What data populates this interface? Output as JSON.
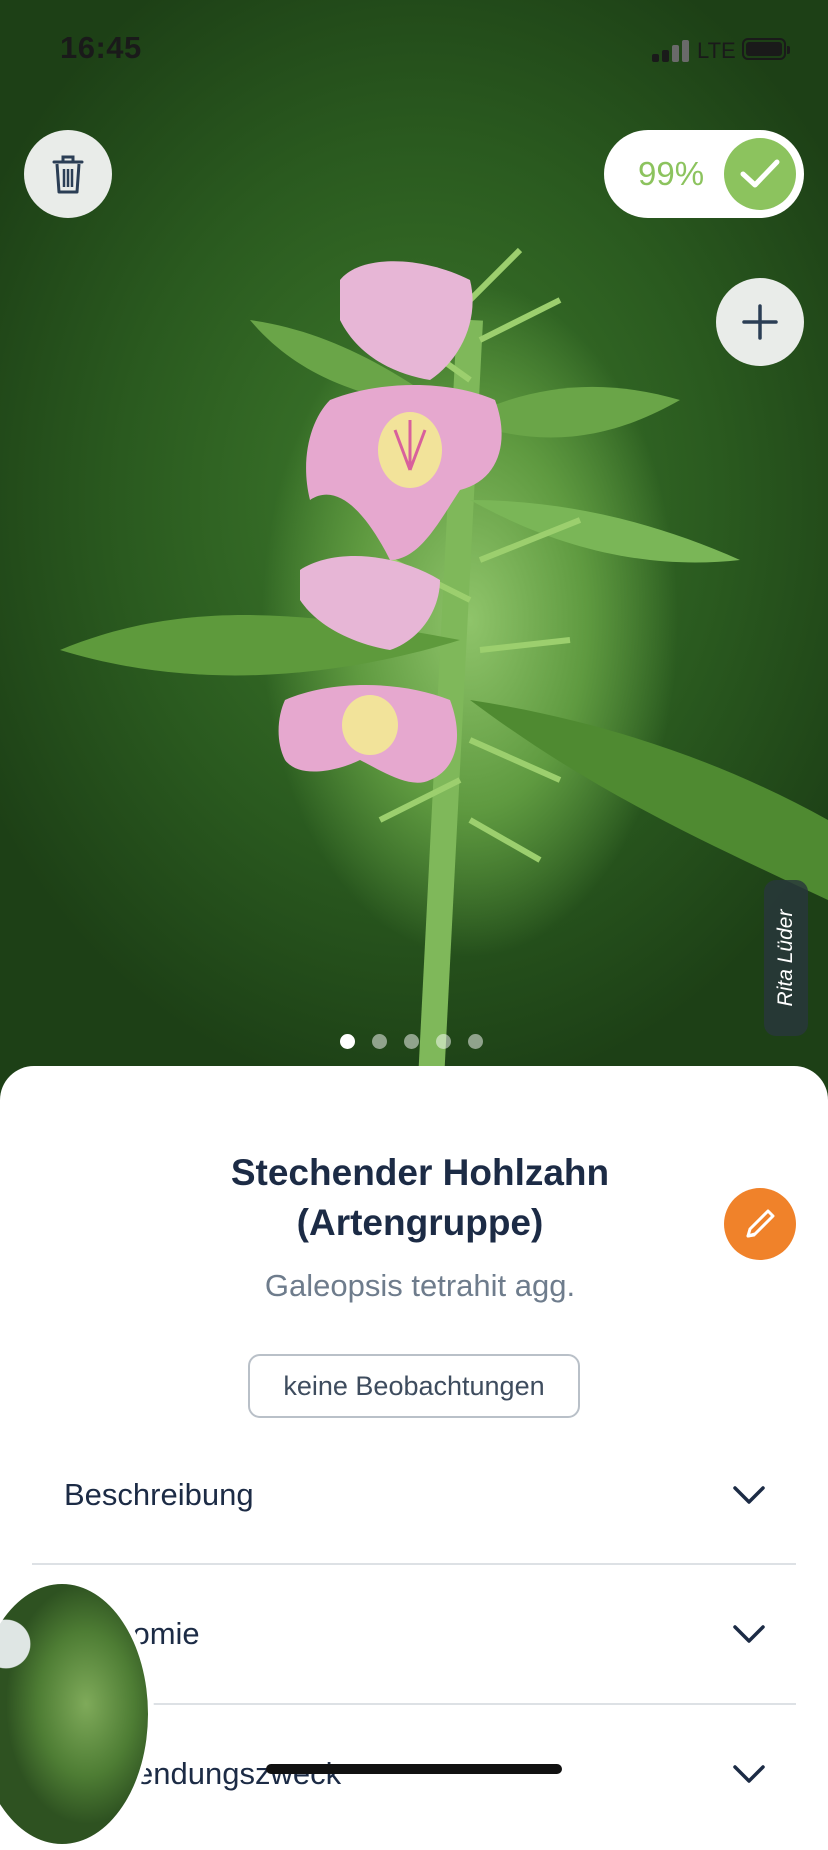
{
  "status_bar": {
    "time": "16:45",
    "network": "LTE",
    "signal_bars_active": 2,
    "signal_bars_total": 4
  },
  "photo": {
    "credit": "Rita Lüder",
    "carousel": {
      "count": 5,
      "active_index": 0
    }
  },
  "actions": {
    "delete_icon": "trash-icon",
    "add_icon": "plus-icon",
    "edit_icon": "pencil-icon"
  },
  "identification": {
    "confidence": "99%",
    "confidence_color": "#8cc35e"
  },
  "species": {
    "common_name_line1": "Stechender Hohlzahn",
    "common_name_line2": "(Artengruppe)",
    "scientific_name": "Galeopsis tetrahit agg.",
    "observations_badge": "keine Beobachtungen"
  },
  "sections": [
    {
      "label": "Beschreibung"
    },
    {
      "label": "onomie"
    },
    {
      "label": "endungszweck"
    }
  ],
  "colors": {
    "accent_orange": "#f0822a",
    "text_dark": "#1c2b45",
    "text_muted": "#6e7c8c"
  }
}
